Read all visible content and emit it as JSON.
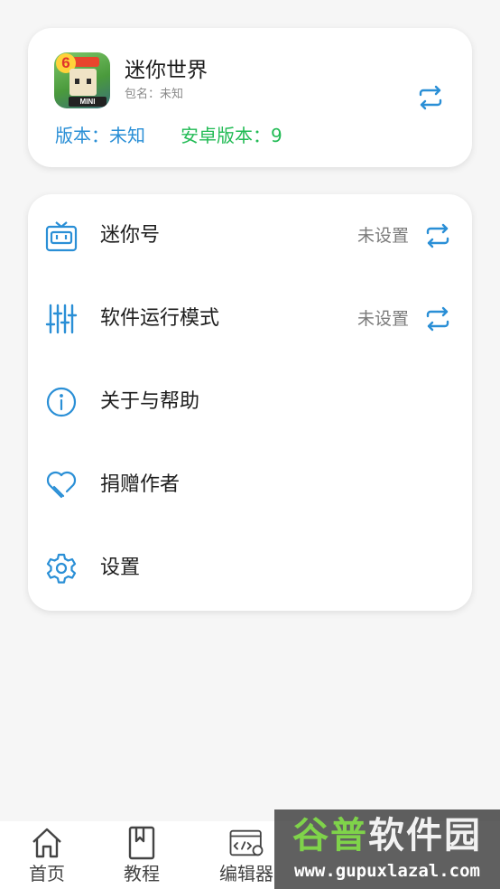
{
  "app_card": {
    "name": "迷你世界",
    "package": "包名：未知",
    "version": "版本：未知",
    "android_version": "安卓版本：9",
    "icon_badge": "6",
    "icon_label": "MINI"
  },
  "menu": {
    "items": [
      {
        "label": "迷你号",
        "value": "未设置",
        "icon": "robot-box-icon",
        "switchable": true
      },
      {
        "label": "软件运行模式",
        "value": "未设置",
        "icon": "sliders-icon",
        "switchable": true
      },
      {
        "label": "关于与帮助",
        "value": "",
        "icon": "info-icon",
        "switchable": false
      },
      {
        "label": "捐赠作者",
        "value": "",
        "icon": "heart-icon",
        "switchable": false
      },
      {
        "label": "设置",
        "value": "",
        "icon": "gear-icon",
        "switchable": false
      }
    ]
  },
  "bottom_nav": {
    "items": [
      {
        "label": "首页",
        "icon": "home-icon"
      },
      {
        "label": "教程",
        "icon": "bookmark-book-icon"
      },
      {
        "label": "编辑器",
        "icon": "code-settings-icon"
      }
    ]
  },
  "watermark": {
    "title_green": "谷普",
    "title_white": "软件园",
    "url": "www.gupuxlazal.com"
  },
  "colors": {
    "accent_blue": "#2a8fd6",
    "accent_green": "#22bb55",
    "background": "#f6f6f6",
    "card": "#ffffff"
  }
}
